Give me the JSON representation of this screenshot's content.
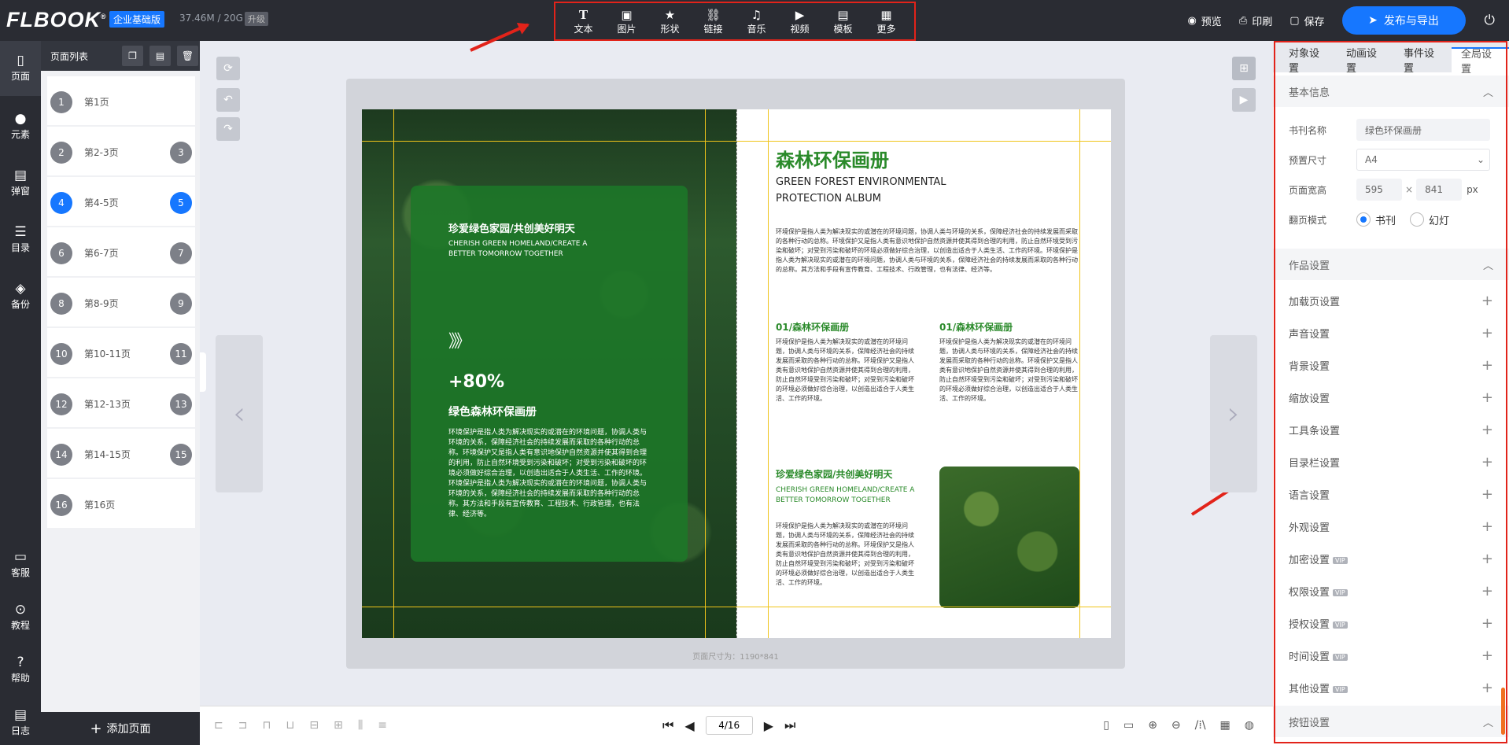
{
  "app": {
    "logo": "FLBOOK",
    "logo_mark": "®",
    "edition": "企业基础版",
    "storage": "37.46M / 20G",
    "upgrade": "升级"
  },
  "toolbar": {
    "items": [
      {
        "label": "文本",
        "icon": "text-icon"
      },
      {
        "label": "图片",
        "icon": "image-icon"
      },
      {
        "label": "形状",
        "icon": "star-icon"
      },
      {
        "label": "链接",
        "icon": "link-icon"
      },
      {
        "label": "音乐",
        "icon": "music-icon"
      },
      {
        "label": "视频",
        "icon": "video-icon"
      },
      {
        "label": "模板",
        "icon": "template-icon"
      },
      {
        "label": "更多",
        "icon": "more-icon"
      }
    ]
  },
  "header_actions": {
    "preview": "预览",
    "print": "印刷",
    "save": "保存",
    "publish": "发布与导出"
  },
  "leftnav": {
    "items": [
      "页面",
      "元素",
      "弹窗",
      "目录",
      "备份"
    ],
    "bottom": [
      "客服",
      "教程",
      "帮助",
      "日志"
    ]
  },
  "pagelist": {
    "title": "页面列表",
    "pages": [
      {
        "label": "第1页",
        "left": "1",
        "right": ""
      },
      {
        "label": "第2-3页",
        "left": "2",
        "right": "3"
      },
      {
        "label": "第4-5页",
        "left": "4",
        "right": "5"
      },
      {
        "label": "第6-7页",
        "left": "6",
        "right": "7"
      },
      {
        "label": "第8-9页",
        "left": "8",
        "right": "9"
      },
      {
        "label": "第10-11页",
        "left": "10",
        "right": "11"
      },
      {
        "label": "第12-13页",
        "left": "12",
        "right": "13"
      },
      {
        "label": "第14-15页",
        "left": "14",
        "right": "15"
      },
      {
        "label": "第16页",
        "left": "16",
        "right": ""
      }
    ],
    "add": "添加页面"
  },
  "canvas": {
    "page_size": "页面尺寸为：1190*841",
    "left_page": {
      "title": "珍爱绿色家园/共创美好明天",
      "subtitle": "CHERISH GREEN HOMELAND/CREATE A BETTER TOMORROW TOGETHER",
      "arrows": "》》",
      "percent": "+80%",
      "heading": "绿色森林环保画册",
      "body": "环境保护是指人类为解决现实的或潜在的环境问题，协调人类与环境的关系，保障经济社会的持续发展而采取的各种行动的总称。环境保护又是指人类有意识地保护自然资源并使其得到合理的利用，防止自然环境受到污染和破坏；对受到污染和破坏的环境必须做好综合治理，以创造出适合于人类生活、工作的环境。环境保护是指人类为解决现实的或潜在的环境问题，协调人类与环境的关系，保障经济社会的持续发展而采取的各种行动的总称。其方法和手段有宣传教育、工程技术、行政管理，也有法律、经济等。"
    },
    "right_page": {
      "title": "森林环保画册",
      "subtitle": "GREEN FOREST ENVIRONMENTAL PROTECTION ALBUM",
      "intro": "环境保护是指人类为解决现实的或潜在的环境问题，协调人类与环境的关系，保障经济社会的持续发展而采取的各种行动的总称。环境保护又是指人类有意识地保护自然资源并使其得到合理的利用，防止自然环境受到污染和破坏；对受到污染和破坏的环境必须做好综合治理，以创造出适合于人类生活、工作的环境。环境保护是指人类为解决现实的或潜在的环境问题，协调人类与环境的关系，保障经济社会的持续发展而采取的各种行动的总称。其方法和手段有宣传教育、工程技术、行政管理，也有法律、经济等。",
      "col1_title": "01/森林环保画册",
      "col2_title": "01/森林环保画册",
      "col_body": "环境保护是指人类为解决现实的或潜在的环境问题，协调人类与环境的关系，保障经济社会的持续发展而采取的各种行动的总称。环境保护又是指人类有意识地保护自然资源并使其得到合理的利用，防止自然环境受到污染和破坏；对受到污染和破坏的环境必须做好综合治理，以创造出适合于人类生活、工作的环境。",
      "section_title": "珍爱绿色家园/共创美好明天",
      "section_en": "CHERISH GREEN HOMELAND/CREATE A BETTER TOMORROW TOGETHER",
      "section_body": "环境保护是指人类为解决现实的或潜在的环境问题，协调人类与环境的关系，保障经济社会的持续发展而采取的各种行动的总称。环境保护又是指人类有意识地保护自然资源并使其得到合理的利用，防止自然环境受到污染和破坏；对受到污染和破坏的环境必须做好综合治理，以创造出适合于人类生活、工作的环境。"
    }
  },
  "pager": {
    "current": "4/16"
  },
  "rightpanel": {
    "tabs": [
      "对象设置",
      "动画设置",
      "事件设置",
      "全局设置"
    ],
    "basic": {
      "title": "基本信息",
      "name_label": "书刊名称",
      "name_value": "绿色环保画册",
      "size_label": "预置尺寸",
      "size_value": "A4",
      "wh_label": "页面宽高",
      "width": "595",
      "times": "×",
      "height": "841",
      "unit": "px",
      "mode_label": "翻页模式",
      "mode_book": "书刊",
      "mode_slide": "幻灯"
    },
    "work_title": "作品设置",
    "settings": [
      {
        "label": "加载页设置",
        "vip": ""
      },
      {
        "label": "声音设置",
        "vip": ""
      },
      {
        "label": "背景设置",
        "vip": ""
      },
      {
        "label": "缩放设置",
        "vip": ""
      },
      {
        "label": "工具条设置",
        "vip": ""
      },
      {
        "label": "目录栏设置",
        "vip": ""
      },
      {
        "label": "语言设置",
        "vip": ""
      },
      {
        "label": "外观设置",
        "vip": ""
      },
      {
        "label": "加密设置",
        "vip": "VIP"
      },
      {
        "label": "权限设置",
        "vip": "VIP"
      },
      {
        "label": "授权设置",
        "vip": "VIP"
      },
      {
        "label": "时间设置",
        "vip": "VIP"
      },
      {
        "label": "其他设置",
        "vip": "VIP"
      }
    ],
    "button_title": "按钮设置"
  },
  "colors": {
    "accent": "#1677ff",
    "highlight": "#e2231a",
    "brand_green": "#2a8a2a"
  }
}
